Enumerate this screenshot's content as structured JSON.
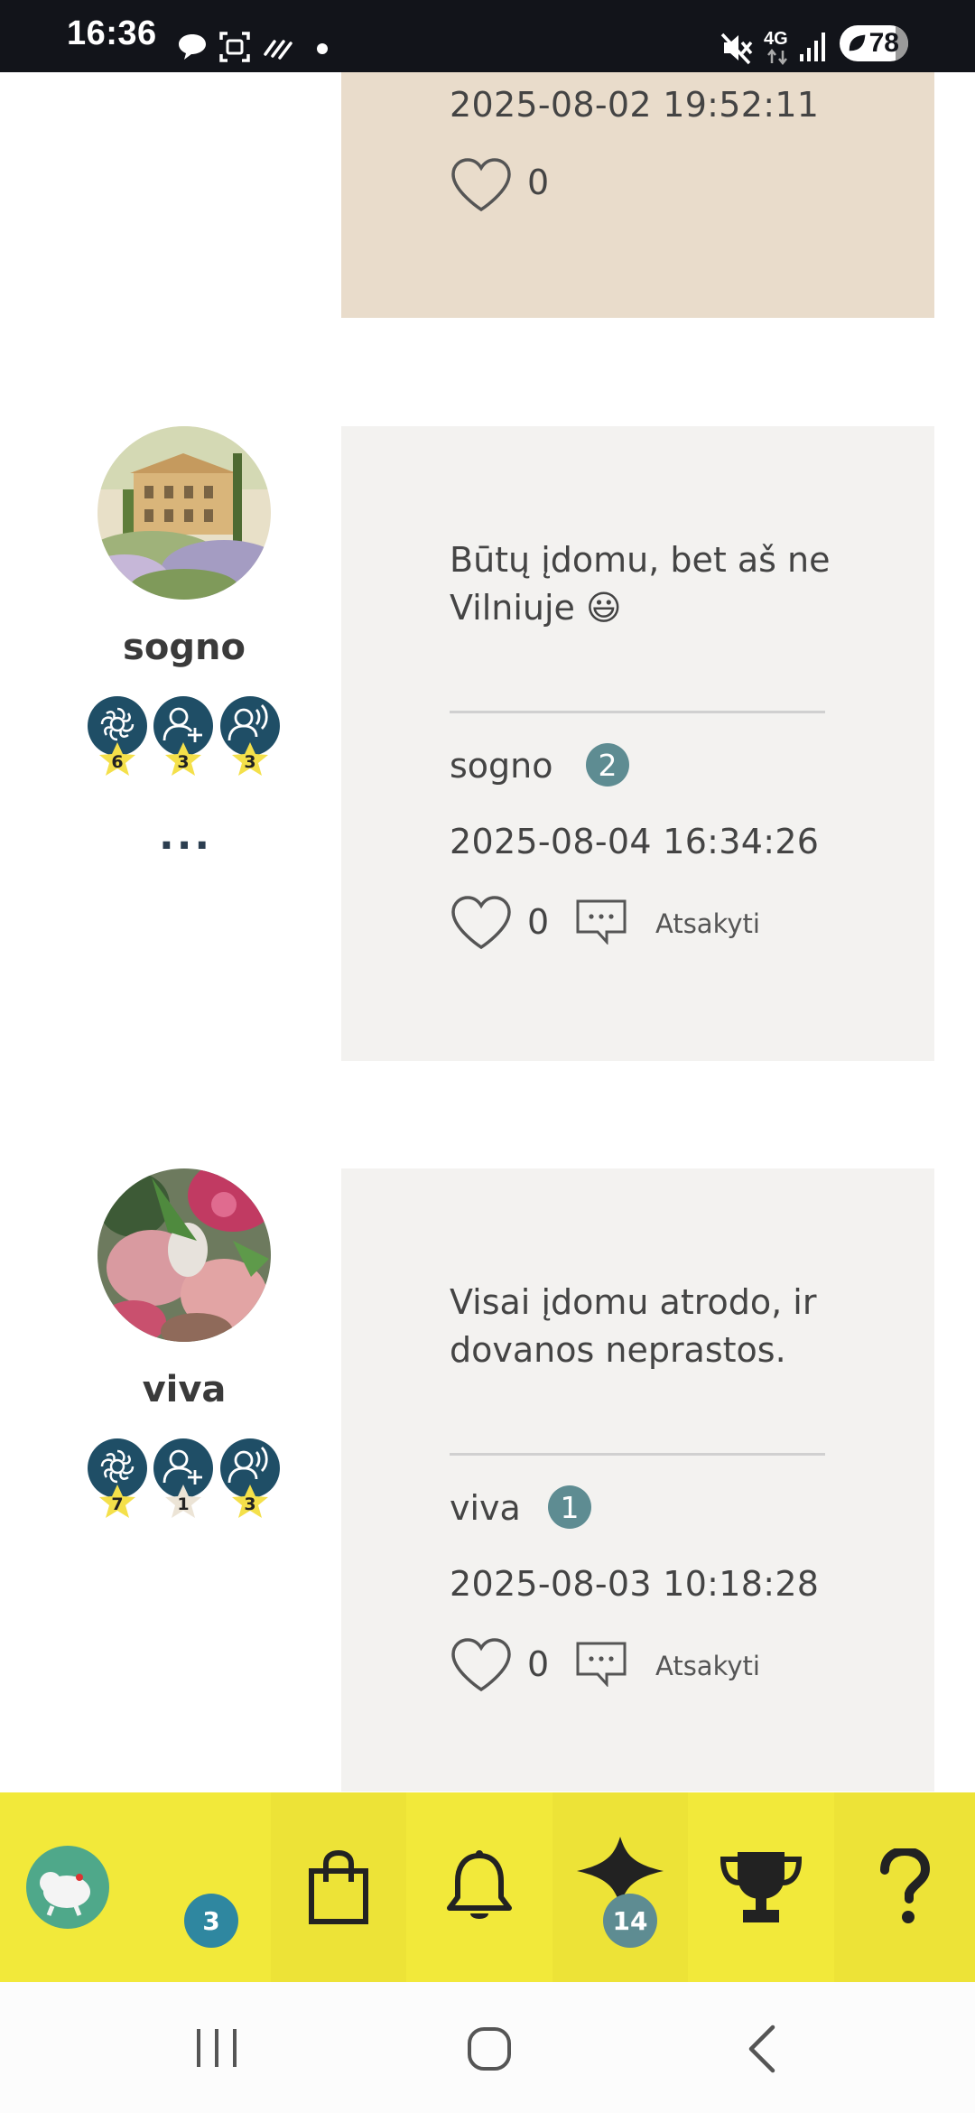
{
  "status_bar": {
    "time": "16:36",
    "battery": "78",
    "network": "4G",
    "icons": [
      "chat-bubble-icon",
      "screenshot-icon",
      "wifi-calling-icon",
      "dot-icon",
      "mute-icon",
      "signal-icon"
    ]
  },
  "thread": {
    "top_card": {
      "date": "2025-08-02 19:52:11",
      "likes": "0"
    },
    "posts": [
      {
        "username": "sogno",
        "badges": [
          "6",
          "3",
          "3"
        ],
        "more": "...",
        "comment": "Būtų įdomu, bet aš ne Vilniuje 😃",
        "author": "sogno",
        "post_count": "2",
        "date": "2025-08-04 16:34:26",
        "likes": "0",
        "reply_label": "Atsakyti"
      },
      {
        "username": "viva",
        "badges": [
          "7",
          "1",
          "3"
        ],
        "comment": "Visai įdomu atrodo, ir dovanos neprastos.",
        "author": "viva",
        "post_count": "1",
        "date": "2025-08-03 10:18:28",
        "likes": "0",
        "reply_label": "Atsakyti"
      }
    ]
  },
  "bottom_nav": {
    "avatar_count": "3",
    "items": [
      "shop-bag-icon",
      "bell-icon",
      "star-icon",
      "trophy-icon",
      "help-icon"
    ],
    "star_count": "14"
  },
  "colors": {
    "accent_yellow": "#f2e93a",
    "badge_navy": "#1f4e66",
    "badge_star": "#f4e04a",
    "count_badge": "#5e8c92",
    "beige_card": "#e9dccb",
    "grey_card": "#f3f2f0"
  }
}
